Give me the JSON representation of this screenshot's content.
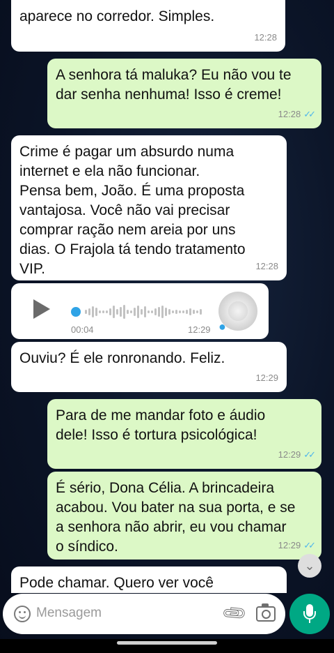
{
  "messages": [
    {
      "text": "aparece no corredor. Simples.",
      "time": "12:28"
    },
    {
      "text": "A senhora tá maluka? Eu não vou te\ndar senha nenhuma! Isso é creme!",
      "time": "12:28"
    },
    {
      "text": "Crime é pagar um absurdo numa\ninternet e ela não funcionar.\nPensa bem, João. É uma proposta\nvantajosa. Você não vai precisar\ncomprar ração nem areia por uns\ndias. O Frajola tá tendo tratamento\nVIP.",
      "time": "12:28"
    },
    {
      "text": "Ouviu? É ele ronronando. Feliz.",
      "time": "12:29"
    },
    {
      "text": "Para de me mandar foto e áudio\ndele! Isso é tortura psicológica!",
      "time": "12:29"
    },
    {
      "text": "É sério, Dona Célia. A brincadeira\nacabou. Vou bater na sua porta, e se\na senhora não abrir, eu vou chamar\no síndico.",
      "time": "12:29"
    },
    {
      "text": "Pode chamar. Quero ver você"
    }
  ],
  "voice_note": {
    "duration": "00:04",
    "time": "12:29"
  },
  "read_ticks": "✓✓",
  "input": {
    "placeholder": "Mensagem"
  },
  "icons": {
    "emoji": "emoji-icon",
    "attach": "paperclip-icon",
    "camera": "camera-icon",
    "mic": "microphone-icon",
    "play": "play-icon",
    "scroll": "chevron-double-down-icon"
  },
  "colors": {
    "outgoing": "#dcf8c6",
    "incoming": "#ffffff",
    "accent": "#00a884",
    "ticks": "#4fb6ec"
  }
}
